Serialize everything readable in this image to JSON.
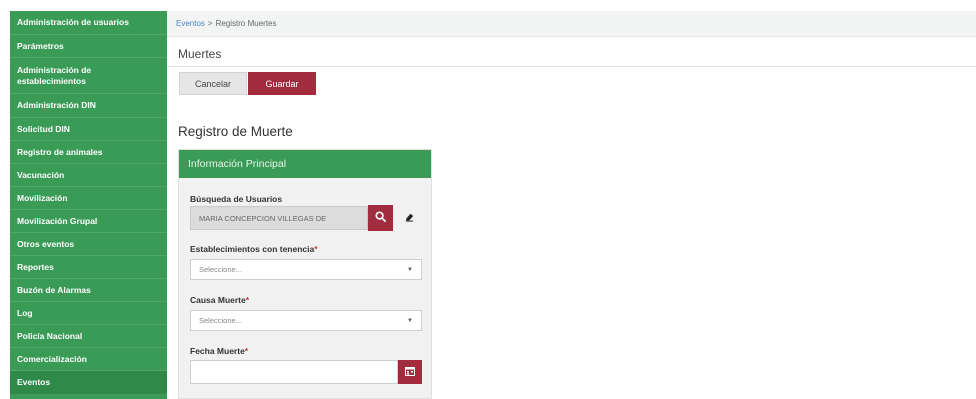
{
  "sidebar": {
    "items": [
      {
        "label": "Administración de usuarios"
      },
      {
        "label": "Parámetros"
      },
      {
        "label": "Administración de establecimientos"
      },
      {
        "label": "Administración DIN"
      },
      {
        "label": "Solicitud DIN"
      },
      {
        "label": "Registro de animales"
      },
      {
        "label": "Vacunación"
      },
      {
        "label": "Movilización"
      },
      {
        "label": "Movilización Grupal"
      },
      {
        "label": "Otros eventos"
      },
      {
        "label": "Reportes"
      },
      {
        "label": "Buzón de Alarmas"
      },
      {
        "label": "Log"
      },
      {
        "label": "Policía Nacional"
      },
      {
        "label": "Comercialización"
      },
      {
        "label": "Eventos"
      }
    ]
  },
  "breadcrumb": {
    "parent": "Eventos",
    "separator": ">",
    "current": "Registro Muertes"
  },
  "header": {
    "title": "Muertes",
    "cancel_label": "Cancelar",
    "save_label": "Guardar"
  },
  "form": {
    "title": "Registro de Muerte",
    "panel_title": "Información Principal",
    "user_search": {
      "label": "Búsqueda de Usuarios",
      "value": "MARIA CONCEPCION VILLEGAS DE"
    },
    "establishment": {
      "label": "Establecimientos con tenencia",
      "required_mark": "*",
      "selected": "Seleccione..."
    },
    "cause": {
      "label": "Causa Muerte",
      "required_mark": "*",
      "selected": "Seleccione..."
    },
    "date": {
      "label": "Fecha Muerte",
      "required_mark": "*"
    }
  },
  "icons": {
    "search": "search-icon",
    "eraser": "eraser-icon",
    "calendar": "calendar-icon",
    "dropdown": "chevron-down-icon"
  },
  "colors": {
    "sidebar_bg": "#3a9b57",
    "panel_header": "#3a9b57",
    "accent": "#a02c3e"
  }
}
